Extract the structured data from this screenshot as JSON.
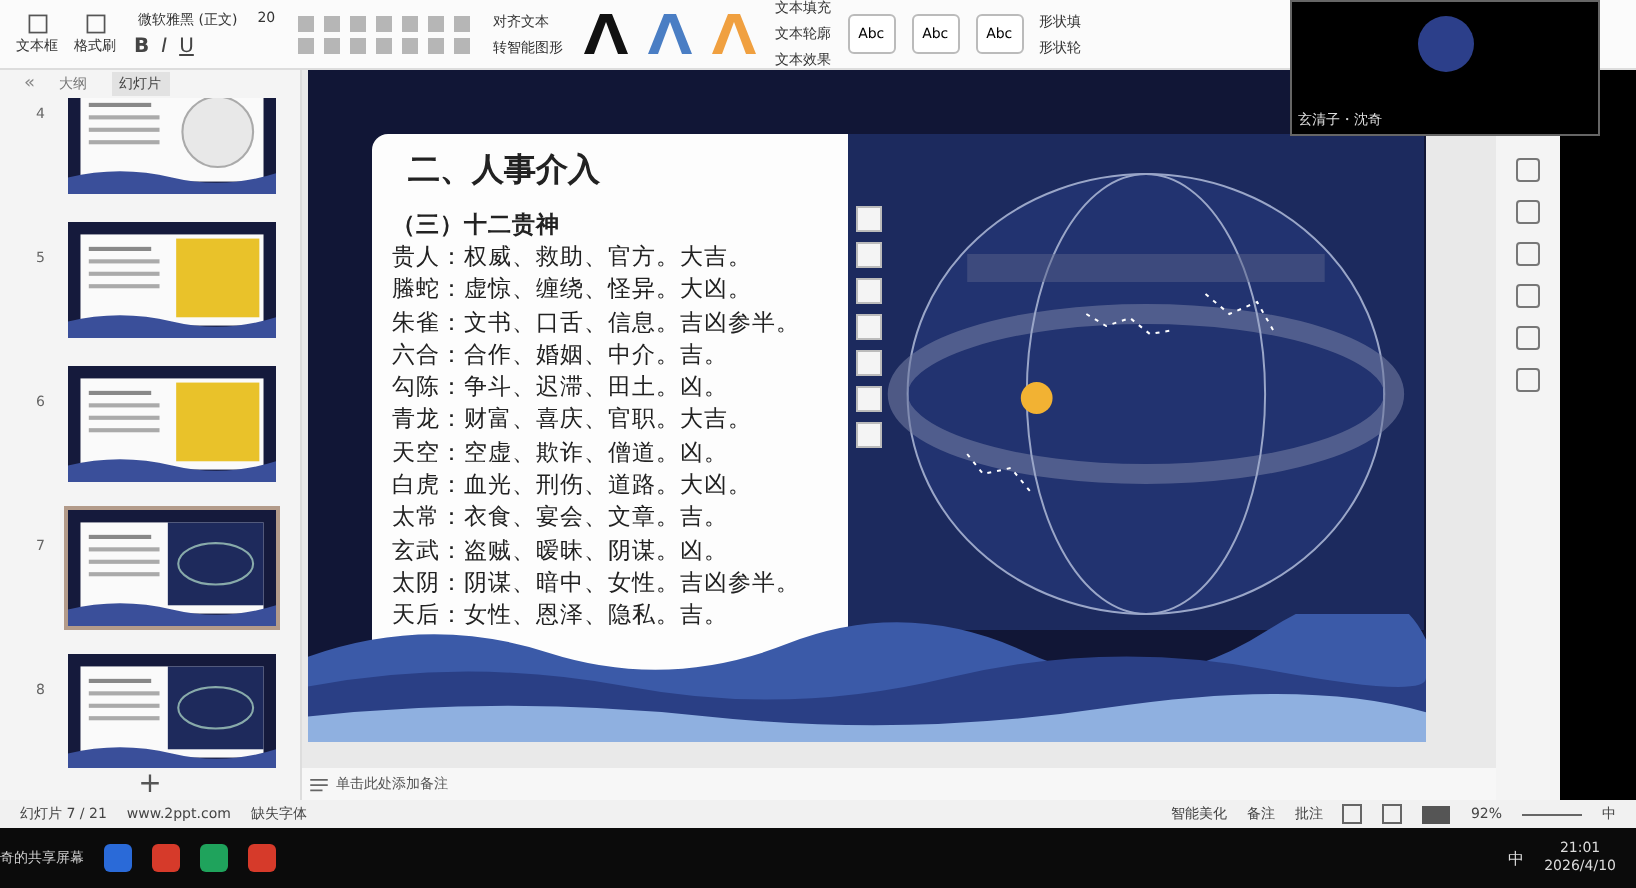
{
  "toolbar": {
    "big_buttons": [
      {
        "label": "文本框"
      },
      {
        "label": "格式刷"
      }
    ],
    "font": "微软雅黑 (正文)",
    "font_size": "20",
    "format_buttons": [
      "B",
      "I",
      "U"
    ],
    "text_tools": [
      "对齐文本",
      "转智能图形"
    ],
    "text_effects": [
      "文本填充",
      "文本轮廓",
      "文本效果"
    ],
    "shape_styles": [
      "Abc",
      "Abc",
      "Abc"
    ],
    "shape_tools": [
      "形状填",
      "形状轮"
    ]
  },
  "video": {
    "caption": "玄清子・沈奇"
  },
  "panel": {
    "collapse_label": "«",
    "tabs": [
      {
        "label": "大纲",
        "selected": false
      },
      {
        "label": "幻灯片",
        "selected": true
      }
    ],
    "slides": [
      {
        "number": "4",
        "kind": "globe",
        "selected": false
      },
      {
        "number": "5",
        "kind": "yellow",
        "selected": false
      },
      {
        "number": "6",
        "kind": "yellow",
        "selected": false
      },
      {
        "number": "7",
        "kind": "sky",
        "selected": true
      },
      {
        "number": "8",
        "kind": "sky",
        "selected": false
      }
    ],
    "add_label": "+"
  },
  "slide": {
    "title": "二、人事介入",
    "subtitle": "（三）十二贵神",
    "lines": [
      "贵人：权威、救助、官方。大吉。",
      "螣蛇：虚惊、缠绕、怪异。大凶。",
      "朱雀：文书、口舌、信息。吉凶参半。",
      "六合：合作、婚姻、中介。吉。",
      "勾陈：争斗、迟滞、田土。凶。",
      "青龙：财富、喜庆、官职。大吉。",
      "天空：空虚、欺诈、僧道。凶。",
      "白虎：血光、刑伤、道路。大凶。",
      "太常：衣食、宴会、文章。吉。",
      "玄武：盗贼、暧昧、阴谋。凶。",
      "太阴：阴谋、暗中、女性。吉凶参半。",
      "天后：女性、恩泽、隐私。吉。"
    ]
  },
  "notes": {
    "placeholder": "单击此处添加备注"
  },
  "status_bar": {
    "slide_count": "幻灯片 7 / 21",
    "website": "www.2ppt.com",
    "missing_fonts": "缺失字体",
    "beautify": "智能美化",
    "notes": "备注",
    "comments": "批注",
    "zoom": "92%",
    "ime": "中"
  },
  "taskbar": {
    "share_label": "奇的共享屏幕",
    "ime": "中",
    "time": "21:01",
    "date": "2026/4/10"
  }
}
